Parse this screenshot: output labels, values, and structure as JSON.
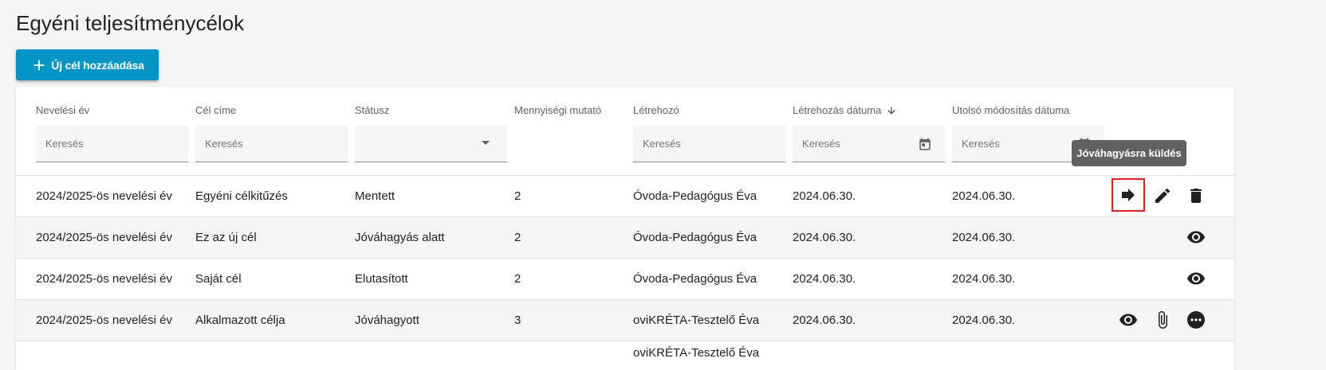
{
  "page": {
    "title": "Egyéni teljesítménycélok"
  },
  "toolbar": {
    "add_label": "Új cél hozzáadása",
    "add_icon": "plus-icon"
  },
  "table": {
    "columns": [
      {
        "key": "year",
        "label": "Nevelési év",
        "filter": "text",
        "placeholder": "Keresés"
      },
      {
        "key": "title",
        "label": "Cél címe",
        "filter": "text",
        "placeholder": "Keresés"
      },
      {
        "key": "status",
        "label": "Státusz",
        "filter": "select",
        "placeholder": ""
      },
      {
        "key": "quantity",
        "label": "Mennyiségi mutató",
        "filter": "none"
      },
      {
        "key": "creator",
        "label": "Létrehozó",
        "filter": "text",
        "placeholder": "Keresés"
      },
      {
        "key": "created",
        "label": "Létrehozás dátuma",
        "filter": "date",
        "placeholder": "Keresés",
        "sort": "descending"
      },
      {
        "key": "modified",
        "label": "Utolsó módosítás dátuma",
        "filter": "date",
        "placeholder": "Keresés"
      }
    ],
    "rows": [
      {
        "year": "2024/2025-ös nevelési év",
        "title": "Egyéni célkitűzés",
        "status": "Mentett",
        "quantity": "2",
        "creator": "Óvoda-Pedagógus Éva",
        "created": "2024.06.30.",
        "modified": "2024.06.30.",
        "actions": [
          "send-for-approval-icon",
          "edit-icon",
          "delete-icon"
        ]
      },
      {
        "year": "2024/2025-ös nevelési év",
        "title": "Ez az új cél",
        "status": "Jóváhagyás alatt",
        "quantity": "2",
        "creator": "Óvoda-Pedagógus Éva",
        "created": "2024.06.30.",
        "modified": "2024.06.30.",
        "actions": [
          "view-icon"
        ]
      },
      {
        "year": "2024/2025-ös nevelési év",
        "title": "Saját cél",
        "status": "Elutasított",
        "quantity": "2",
        "creator": "Óvoda-Pedagógus Éva",
        "created": "2024.06.30.",
        "modified": "2024.06.30.",
        "actions": [
          "view-icon"
        ]
      },
      {
        "year": "2024/2025-ös nevelési év",
        "title": "Alkalmazott célja",
        "status": "Jóváhagyott",
        "quantity": "3",
        "creator": "oviKRÉTA-Tesztelő Éva",
        "created": "2024.06.30.",
        "modified": "2024.06.30.",
        "actions": [
          "view-icon",
          "attachment-icon",
          "more-icon"
        ]
      }
    ],
    "partial_row_text": "oviKRÉTA-Tesztelő Éva"
  },
  "tooltip": {
    "text": "Jóváhagyásra küldés"
  },
  "colors": {
    "primary": "#0295c6",
    "highlight_border": "#e02020",
    "tooltip_bg": "#616161",
    "alt_row_bg": "#f5f5f5"
  }
}
